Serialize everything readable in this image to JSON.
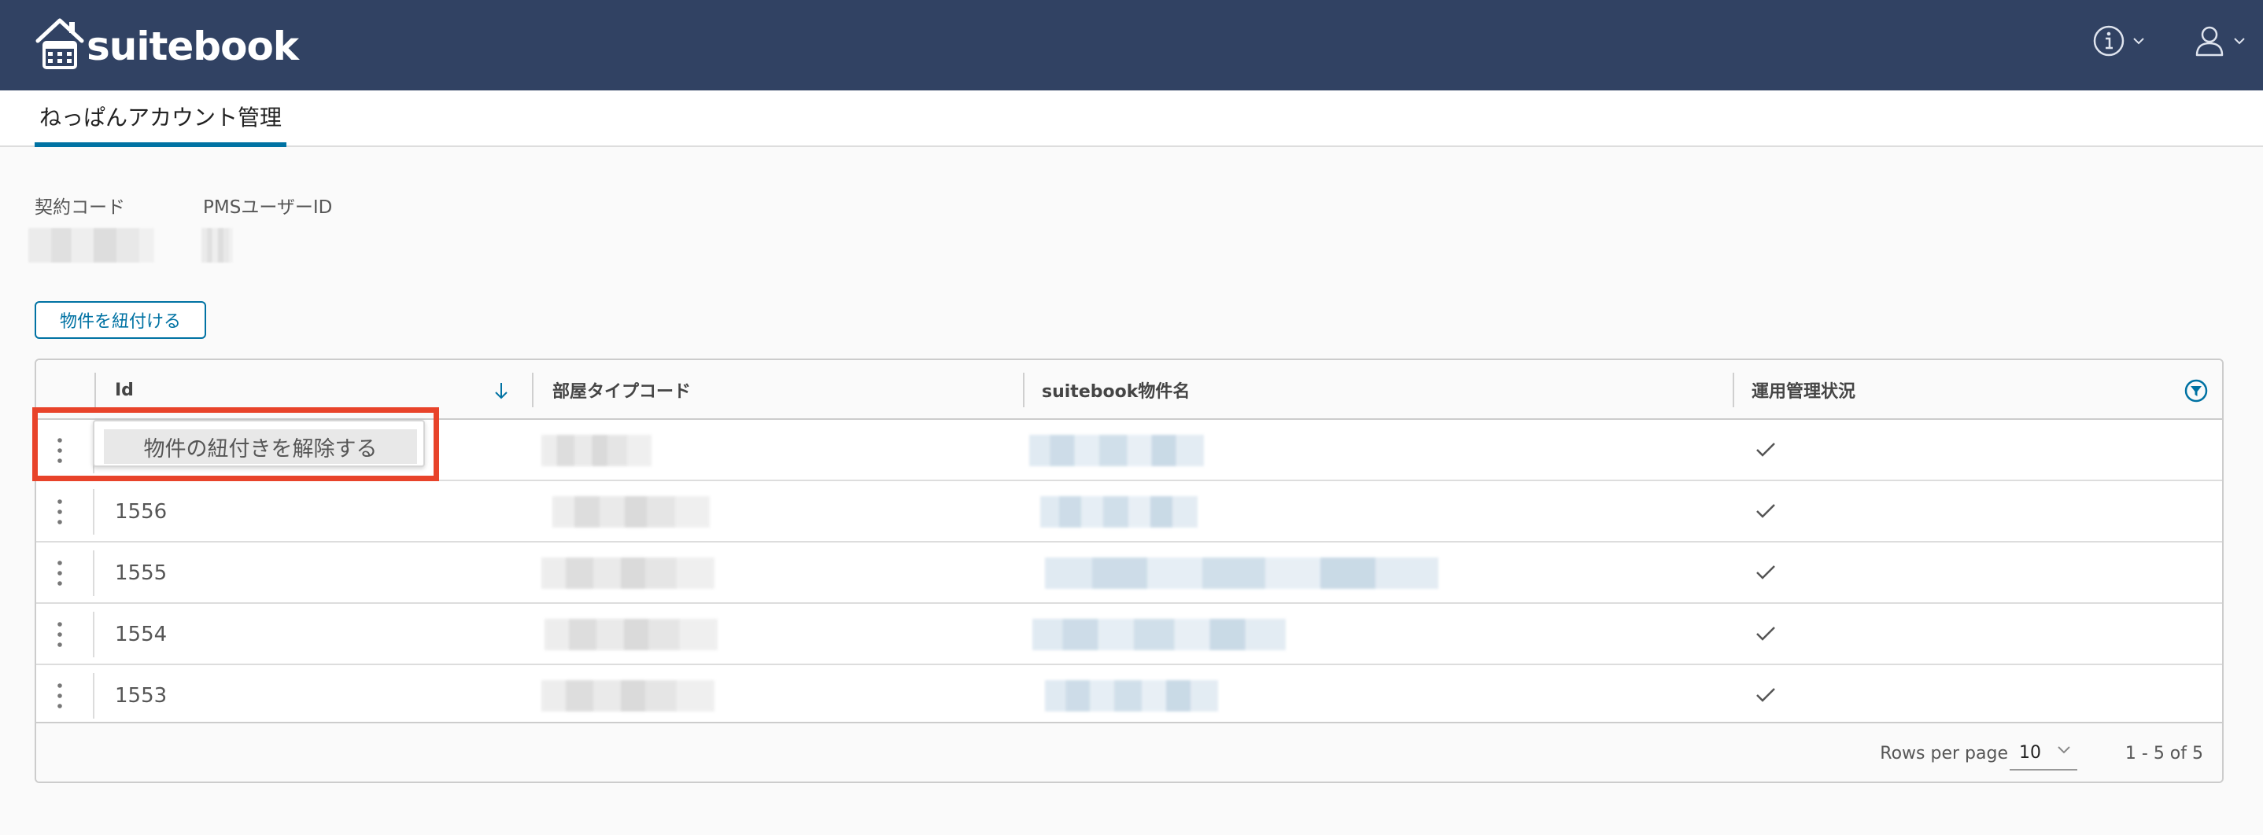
{
  "header": {
    "brand_name": "suitebook",
    "icons": [
      "house-calendar-logo-icon",
      "info-icon",
      "user-icon",
      "chevron-down-icon"
    ]
  },
  "page_tab": {
    "label": "ねっぱんアカウント管理"
  },
  "details": {
    "contract_code_label": "契約コード",
    "pms_user_id_label": "PMSユーザーID"
  },
  "link_button": {
    "label": "物件を紐付ける"
  },
  "grid": {
    "columns": [
      "Id",
      "部屋タイプコード",
      "suitebook物件名",
      "運用管理状況"
    ],
    "rows": [
      {
        "id": "",
        "managed": true
      },
      {
        "id": "1556",
        "managed": true
      },
      {
        "id": "1555",
        "managed": true
      },
      {
        "id": "1554",
        "managed": true
      },
      {
        "id": "1553",
        "managed": true
      }
    ],
    "row_action_label": "物件の紐付きを解除する",
    "footer": {
      "rows_per_page_label": "Rows per page",
      "rows_per_page_value": "10",
      "range_text": "1 - 5 of 5"
    }
  },
  "colors": {
    "header_bg": "#314263",
    "accent": "#0072a3",
    "highlight": "#e8432a"
  }
}
